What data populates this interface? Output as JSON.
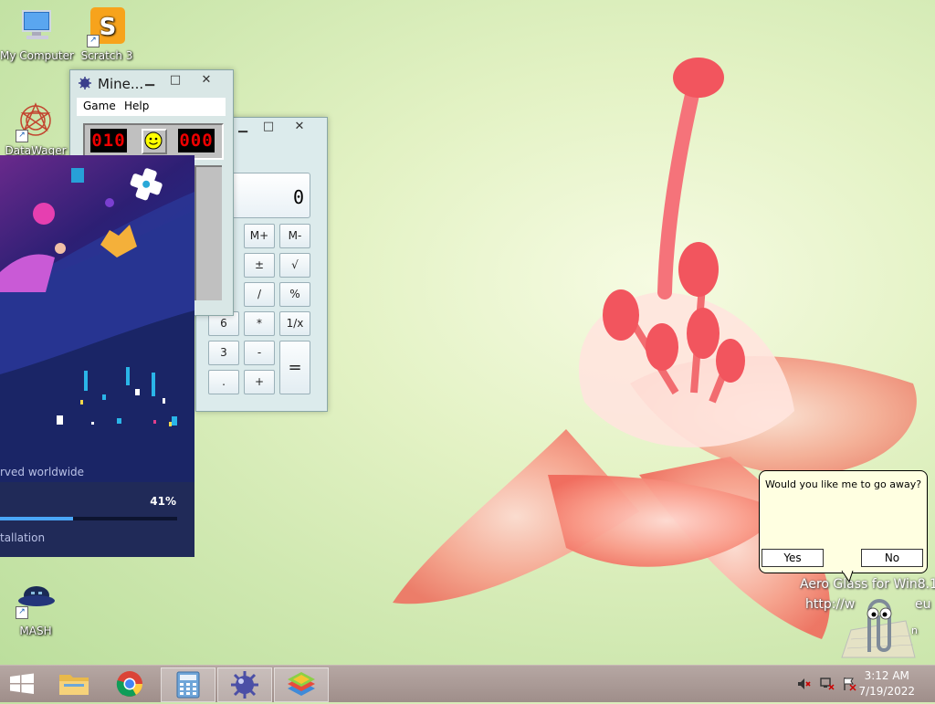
{
  "desktop": {
    "icons": [
      {
        "label": "My Computer"
      },
      {
        "label": "Scratch 3"
      },
      {
        "label": "DataWager"
      },
      {
        "label": "MASH"
      }
    ]
  },
  "minesweeper": {
    "title": "Mine...",
    "menu": [
      "Game",
      "Help"
    ],
    "mine_counter": "010",
    "timer": "000"
  },
  "calculator": {
    "display": "0",
    "buttons": [
      "M+",
      "M-",
      "±",
      "√",
      "/",
      "%",
      "6",
      "*",
      "1/x",
      "3",
      "-",
      "=",
      ".",
      "+"
    ]
  },
  "installer": {
    "copyright_partial": "rved worldwide",
    "progress_percent": "41%",
    "progress_value": 0.41,
    "status_partial": "tallation"
  },
  "clippy": {
    "question": "Would you like me to go away?",
    "yes_label": "Yes",
    "no_label": "No"
  },
  "watermark": {
    "line1": "Aero Glass for Win8.1",
    "line2": "http://w",
    "line2_end": "eu",
    "line3": "n"
  },
  "taskbar": {
    "time": "3:12 AM",
    "date": "7/19/2022"
  },
  "colors": {
    "installer_bg": "#1d2a63",
    "lcd_red": "#e00000",
    "bubble_bg": "#ffffe1"
  }
}
